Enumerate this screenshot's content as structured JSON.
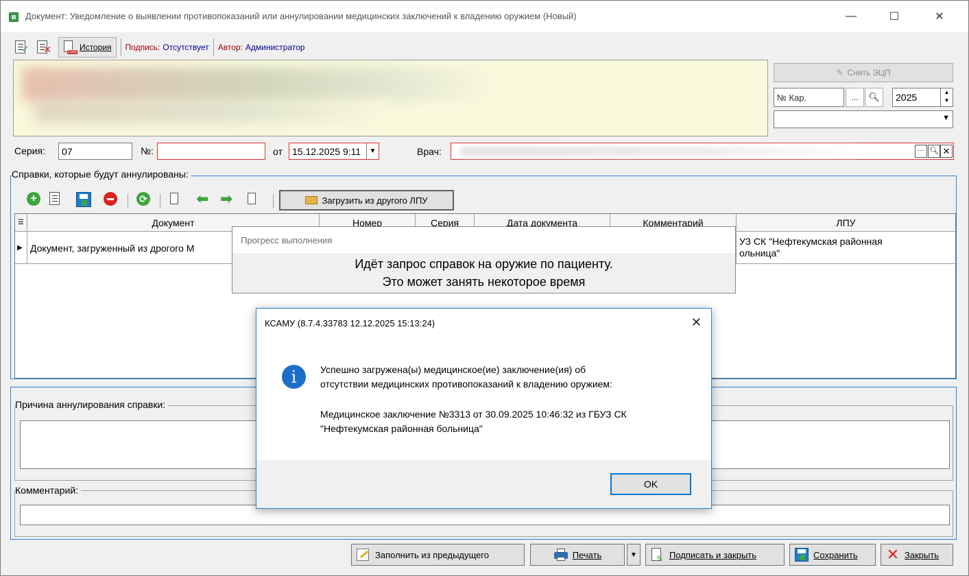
{
  "window": {
    "title": "Документ: Уведомление о выявлении противопоказаний или аннулировании медицинских заключений к владению оружием (Новый)",
    "minimize": "—",
    "maximize": "☐",
    "close": "✕"
  },
  "toolbar": {
    "history_label": "История",
    "signature_label": "Подпись:",
    "signature_value": "Отсутствует",
    "author_label": "Автор:",
    "author_value": "Администратор"
  },
  "right_panel": {
    "remove_ecp_label": "Снять ЭЦП",
    "card_placeholder": "№ Кар.",
    "ellipsis": "...",
    "year_value": "2025"
  },
  "form": {
    "series_label": "Серия:",
    "series_value": "07",
    "number_label": "№:",
    "number_value": "",
    "from_label": "от",
    "date_value": "15.12.2025 9:11",
    "doctor_label": "Врач:",
    "doctor_value": ""
  },
  "certificates": {
    "group_title": "Справки, которые будут аннулированы:",
    "load_button": "Загрузить из другого ЛПУ",
    "columns": [
      "Документ",
      "Номер",
      "Серия",
      "Дата документа",
      "Комментарий",
      "ЛПУ"
    ],
    "rows": [
      {
        "document": "Документ, загруженный из дрогого М",
        "lpu_line1": "УЗ СК \"Нефтекумская районная",
        "lpu_line2": "ольница\""
      }
    ]
  },
  "reason": {
    "group_title": "Причина аннулирования справки:",
    "value": ""
  },
  "comment": {
    "group_title": "Комментарий:",
    "value": ""
  },
  "progress": {
    "title": "Прогресс выполнения",
    "line1": "Идёт запрос справок на оружие по пациенту.",
    "line2": "Это может занять некоторое время"
  },
  "message_box": {
    "title": "КСАМУ (8.7.4.33783 12.12.2025 15:13:24)",
    "line1": "Успешно загружена(ы) медицинское(ие) заключение(ия) об",
    "line2": "отсутствии медицинских противопоказаний к владению оружием:",
    "line3": "Медицинское заключение №3313 от 30.09.2025 10:46:32 из ГБУЗ СК",
    "line4": "\"Нефтекумская районная больница\"",
    "ok_label": "OK"
  },
  "bottom": {
    "fill_prev": "Заполнить из предыдущего",
    "print": "Печать",
    "sign_close": "Подписать и закрыть",
    "save": "Сохранить",
    "close": "Закрыть"
  },
  "colors": {
    "accent_blue": "#2a7fd4",
    "error_red": "#e03030",
    "info_area": "#f9f9dc",
    "dark_red_label": "#a00000",
    "navy_text": "#00008b"
  }
}
